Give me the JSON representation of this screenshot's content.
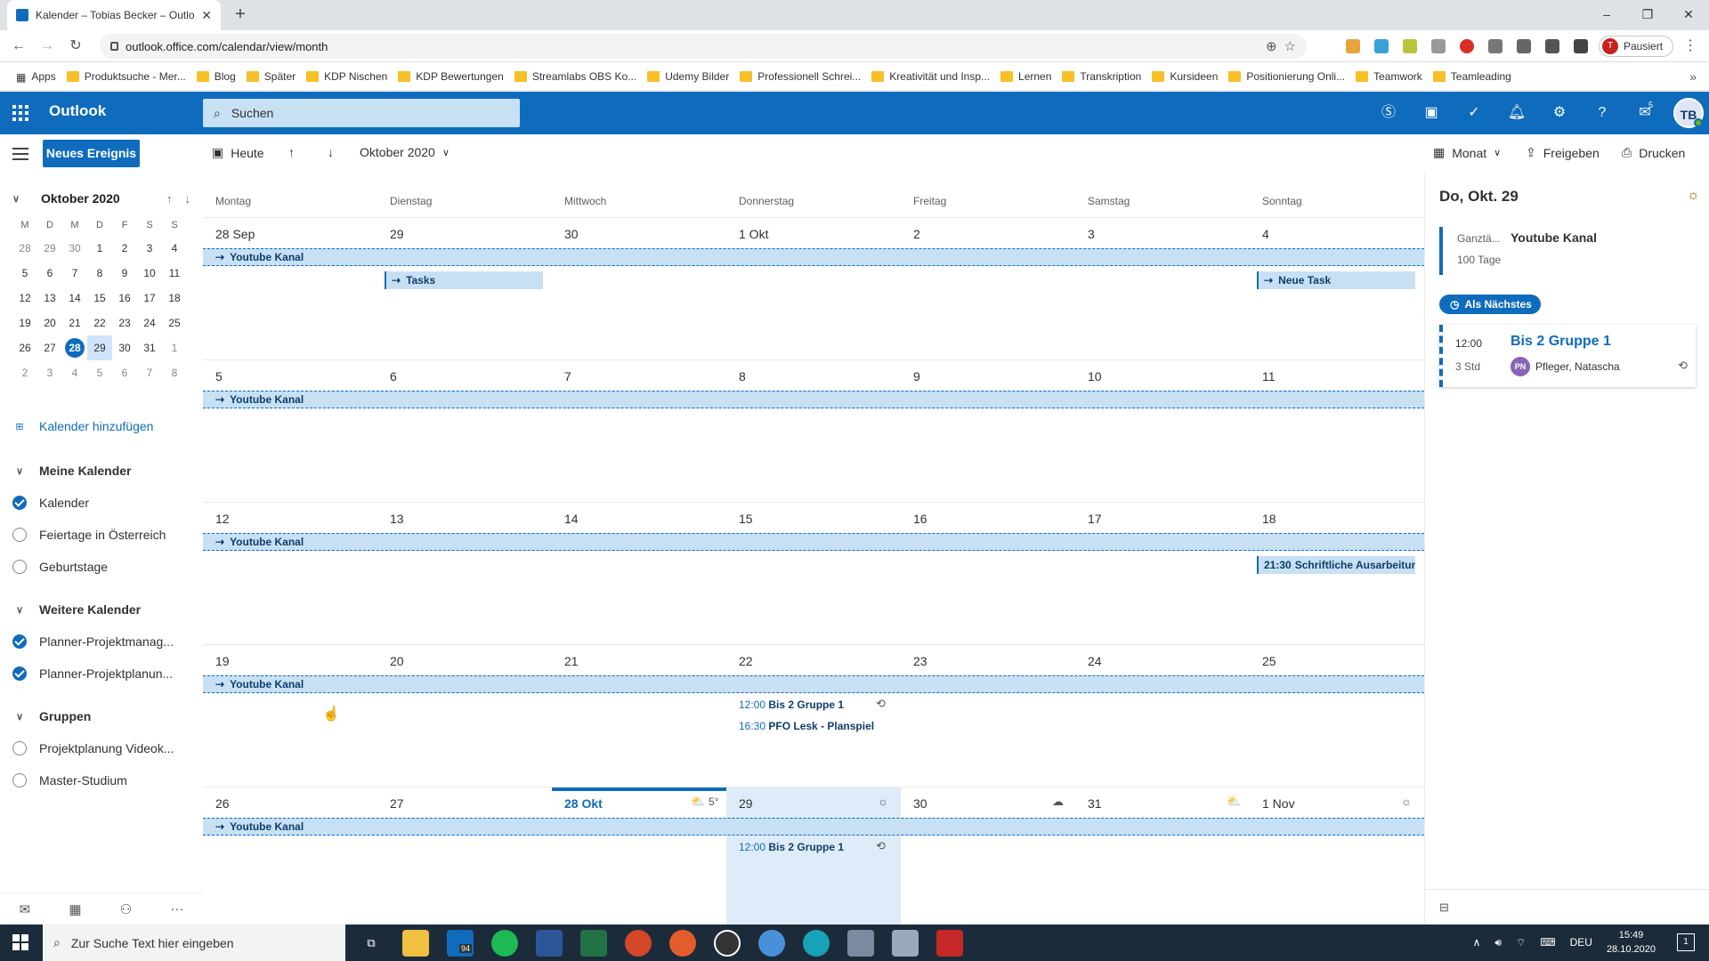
{
  "browser": {
    "tab_title": "Kalender – Tobias Becker – Outlo",
    "url": "outlook.office.com/calendar/view/month",
    "profile_initial": "T",
    "profile_status": "Pausiert",
    "bookmarks": [
      "Apps",
      "Produktsuche - Mer...",
      "Blog",
      "Später",
      "KDP Nischen",
      "KDP Bewertungen",
      "Streamlabs OBS Ko...",
      "Udemy Bilder",
      "Professionell Schrei...",
      "Kreativität und Insp...",
      "Lernen",
      "Transkription",
      "Kursideen",
      "Positionierung Onli...",
      "Teamwork",
      "Teamleading"
    ]
  },
  "header": {
    "brand": "Outlook",
    "search_placeholder": "Suchen",
    "notification_count": "5",
    "avatar": "TB"
  },
  "left": {
    "new_event": "Neues Ereignis",
    "mini_title": "Oktober 2020",
    "weekdays": [
      "M",
      "D",
      "M",
      "D",
      "F",
      "S",
      "S"
    ],
    "weeks": [
      [
        [
          "28",
          1
        ],
        [
          "29",
          1
        ],
        [
          "30",
          1
        ],
        [
          "1",
          0
        ],
        [
          "2",
          0
        ],
        [
          "3",
          0
        ],
        [
          "4",
          0
        ]
      ],
      [
        [
          "5",
          0
        ],
        [
          "6",
          0
        ],
        [
          "7",
          0
        ],
        [
          "8",
          0
        ],
        [
          "9",
          0
        ],
        [
          "10",
          0
        ],
        [
          "11",
          0
        ]
      ],
      [
        [
          "12",
          0
        ],
        [
          "13",
          0
        ],
        [
          "14",
          0
        ],
        [
          "15",
          0
        ],
        [
          "16",
          0
        ],
        [
          "17",
          0
        ],
        [
          "18",
          0
        ]
      ],
      [
        [
          "19",
          0
        ],
        [
          "20",
          0
        ],
        [
          "21",
          0
        ],
        [
          "22",
          0
        ],
        [
          "23",
          0
        ],
        [
          "24",
          0
        ],
        [
          "25",
          0
        ]
      ],
      [
        [
          "26",
          0
        ],
        [
          "27",
          0
        ],
        [
          "28",
          2
        ],
        [
          "29",
          3
        ],
        [
          "30",
          0
        ],
        [
          "31",
          0
        ],
        [
          "1",
          1
        ]
      ],
      [
        [
          "2",
          1
        ],
        [
          "3",
          1
        ],
        [
          "4",
          1
        ],
        [
          "5",
          1
        ],
        [
          "6",
          1
        ],
        [
          "7",
          1
        ],
        [
          "8",
          1
        ]
      ]
    ],
    "add_calendar": "Kalender hinzufügen",
    "my_calendars": "Meine Kalender",
    "cal_kalender": "Kalender",
    "cal_feiertage": "Feiertage in Österreich",
    "cal_geburtstage": "Geburtstage",
    "more_calendars": "Weitere Kalender",
    "cal_planner1": "Planner-Projektmanag...",
    "cal_planner2": "Planner-Projektplanun...",
    "groups": "Gruppen",
    "grp1": "Projektplanung Videok...",
    "grp2": "Master-Studium"
  },
  "toolbar": {
    "today": "Heute",
    "month_label": "Oktober 2020",
    "view": "Monat",
    "share": "Freigeben",
    "print": "Drucken"
  },
  "calendar": {
    "day_headers": [
      "Montag",
      "Dienstag",
      "Mittwoch",
      "Donnerstag",
      "Freitag",
      "Samstag",
      "Sonntag"
    ],
    "weeks": [
      [
        "28 Sep",
        "29",
        "30",
        "1 Okt",
        "2",
        "3",
        "4"
      ],
      [
        "5",
        "6",
        "7",
        "8",
        "9",
        "10",
        "11"
      ],
      [
        "12",
        "13",
        "14",
        "15",
        "16",
        "17",
        "18"
      ],
      [
        "19",
        "20",
        "21",
        "22",
        "23",
        "24",
        "25"
      ],
      [
        "26",
        "27",
        "28 Okt",
        "29",
        "30",
        "31",
        "1 Nov"
      ]
    ],
    "band_title": "Youtube Kanal",
    "ev_tasks": "Tasks",
    "ev_neue_task": "Neue Task",
    "ev_schrift_time": "21:30",
    "ev_schrift_title": "Schriftliche Ausarbeitung",
    "ev_bis2_time": "12:00",
    "ev_bis2_title": "Bis 2 Gruppe 1",
    "ev_pfo_time": "16:30",
    "ev_pfo_title": "PFO Lesk - Planspiel",
    "weather_temp": "5°"
  },
  "right": {
    "title": "Do, Okt. 29",
    "allday_label": "Ganztä...",
    "allday_title": "Youtube Kanal",
    "allday_duration": "100 Tage",
    "next_button": "Als Nächstes",
    "next_time": "12:00",
    "next_duration": "3 Std",
    "next_title": "Bis 2 Gruppe 1",
    "next_initials": "PN",
    "next_person": "Pfleger, Natascha"
  },
  "taskbar": {
    "search_placeholder": "Zur Suche Text hier eingeben",
    "mail_badge": "94",
    "lang": "DEU",
    "time": "15:49",
    "date": "28.10.2020",
    "notif_count": "1"
  },
  "colors": {
    "accent": "#0f6cbd",
    "band": "#c7e0f4",
    "today_col": "#deecf9"
  }
}
